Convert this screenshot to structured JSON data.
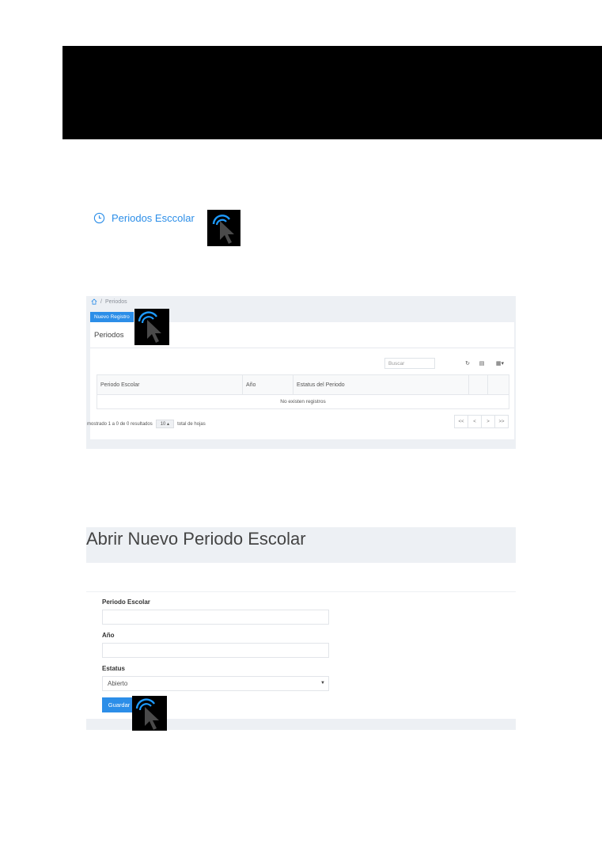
{
  "step_link": {
    "icon": "clock-icon",
    "label": "Periodos Esccolar"
  },
  "list_panel": {
    "breadcrumb": {
      "home_icon": "home-icon",
      "separator": "/",
      "current": "Periodos"
    },
    "new_button": "Nuevo Registro",
    "card_title": "Periodos",
    "search_placeholder": "Buscar",
    "toolbar": {
      "refresh_icon": "refresh-icon",
      "refresh": "↻",
      "view_icon": "list-view-icon",
      "view": "▤",
      "columns_icon": "columns-icon",
      "columns": "▦▾"
    },
    "columns": [
      "Periodo Escolar",
      "Año",
      "Estatus del Periodo"
    ],
    "empty_text": "No existen registros",
    "footer": {
      "showing": "mostrado 1 a 0 de 0 resultados",
      "per_page": "10 ▴",
      "total": "total de hojas"
    },
    "pager": [
      "<<",
      "<",
      ">",
      ">>"
    ]
  },
  "form_panel": {
    "title": "Abrir Nuevo Periodo Escolar",
    "fields": {
      "periodo_label": "Periodo Escolar",
      "periodo_value": "",
      "anio_label": "Año",
      "anio_value": "",
      "estatus_label": "Estatus",
      "estatus_value": "Abierto",
      "estatus_arrow": "▼"
    },
    "save_button": "Guardar"
  },
  "colors": {
    "accent": "#2c8ee8",
    "panel_bg": "#edf0f4",
    "cursor_bg": "#000000"
  }
}
